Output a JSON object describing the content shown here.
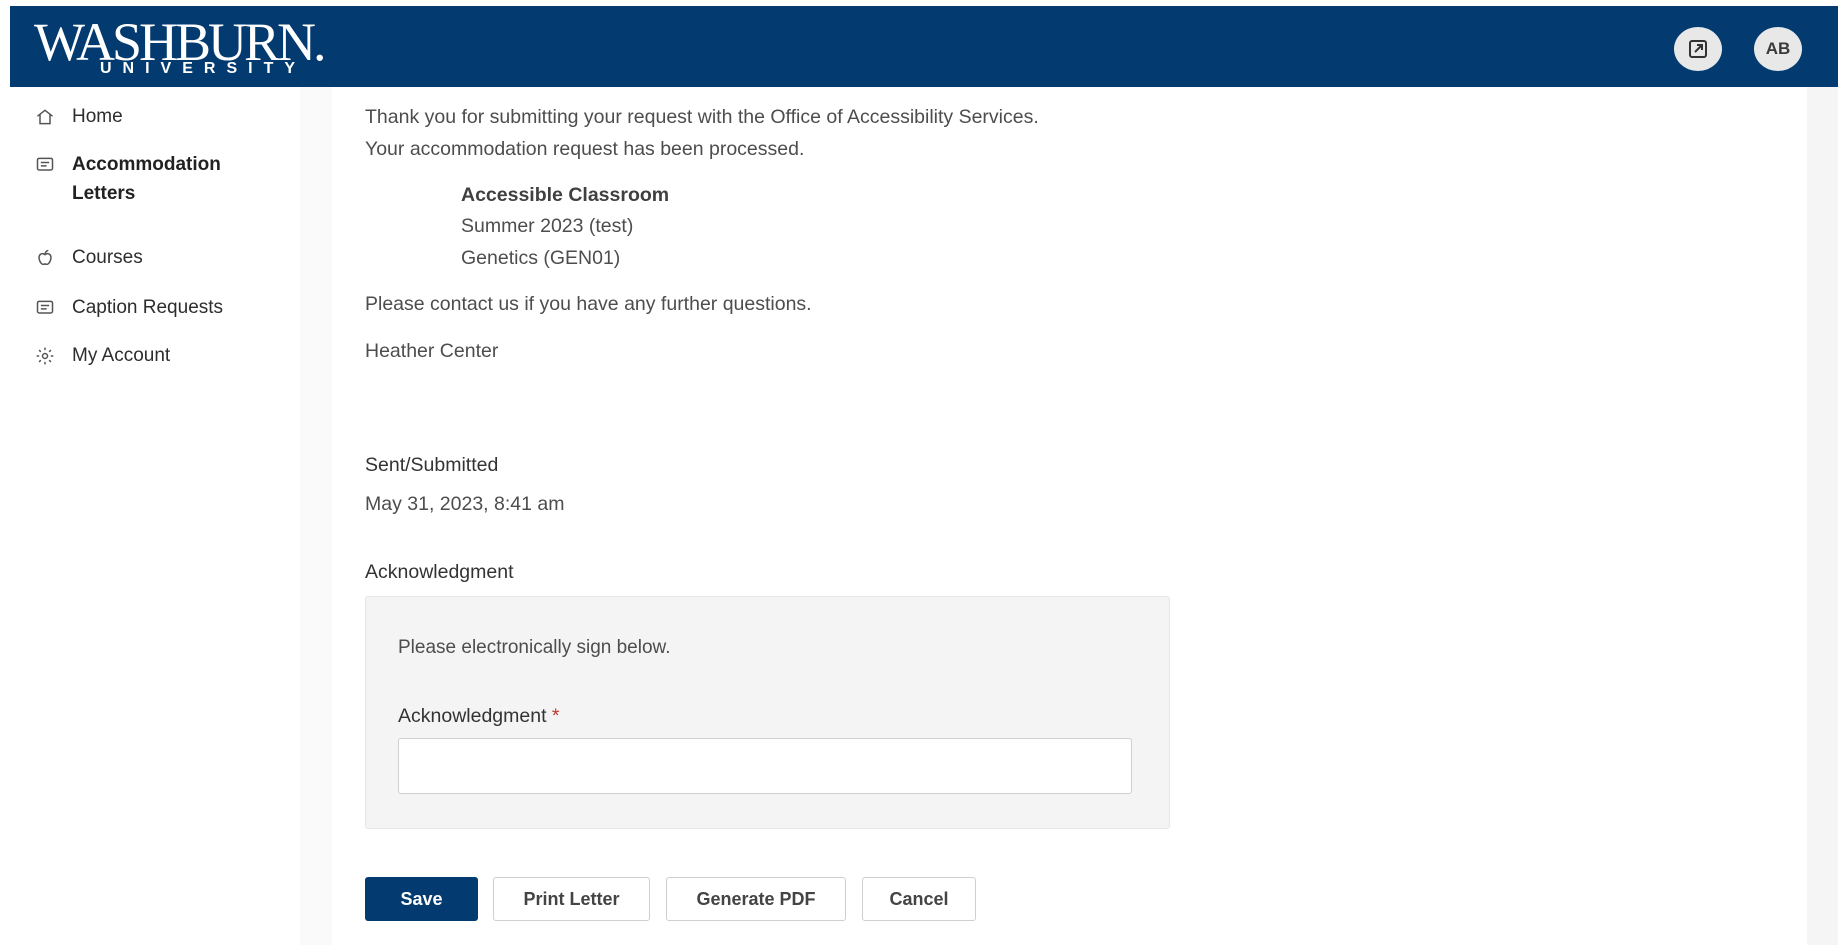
{
  "brand": {
    "logo_main": "WASHBURN.",
    "logo_sub": "UNIVERSITY",
    "primary_color": "#033a70"
  },
  "header": {
    "dialog_icon": "open-in-window-icon",
    "avatar_initials": "AB"
  },
  "sidebar": {
    "items": [
      {
        "label": "Home",
        "icon": "home-icon"
      },
      {
        "label": "Accommodation Letters",
        "icon": "message-icon",
        "active": true
      },
      {
        "label": "Courses",
        "icon": "apple-icon"
      },
      {
        "label": "Caption Requests",
        "icon": "message-icon"
      },
      {
        "label": "My Account",
        "icon": "gear-icon"
      }
    ]
  },
  "letter": {
    "intro_line1": "Thank you for submitting your request with the Office of Accessibility Services.",
    "intro_line2": "Your accommodation request has been processed.",
    "accommodation": "Accessible Classroom",
    "term": "Summer 2023 (test)",
    "course": "Genetics (GEN01)",
    "contact_line": "Please contact us if you have any further questions.",
    "signature": "Heather Center"
  },
  "sent": {
    "label": "Sent/Submitted",
    "value": "May 31, 2023, 8:41 am"
  },
  "acknowledgment": {
    "section_label": "Acknowledgment",
    "instruction": "Please electronically sign below.",
    "field_label": "Acknowledgment",
    "required_mark": "*",
    "value": "",
    "placeholder": ""
  },
  "actions": {
    "save": "Save",
    "print": "Print Letter",
    "pdf": "Generate PDF",
    "cancel": "Cancel"
  }
}
